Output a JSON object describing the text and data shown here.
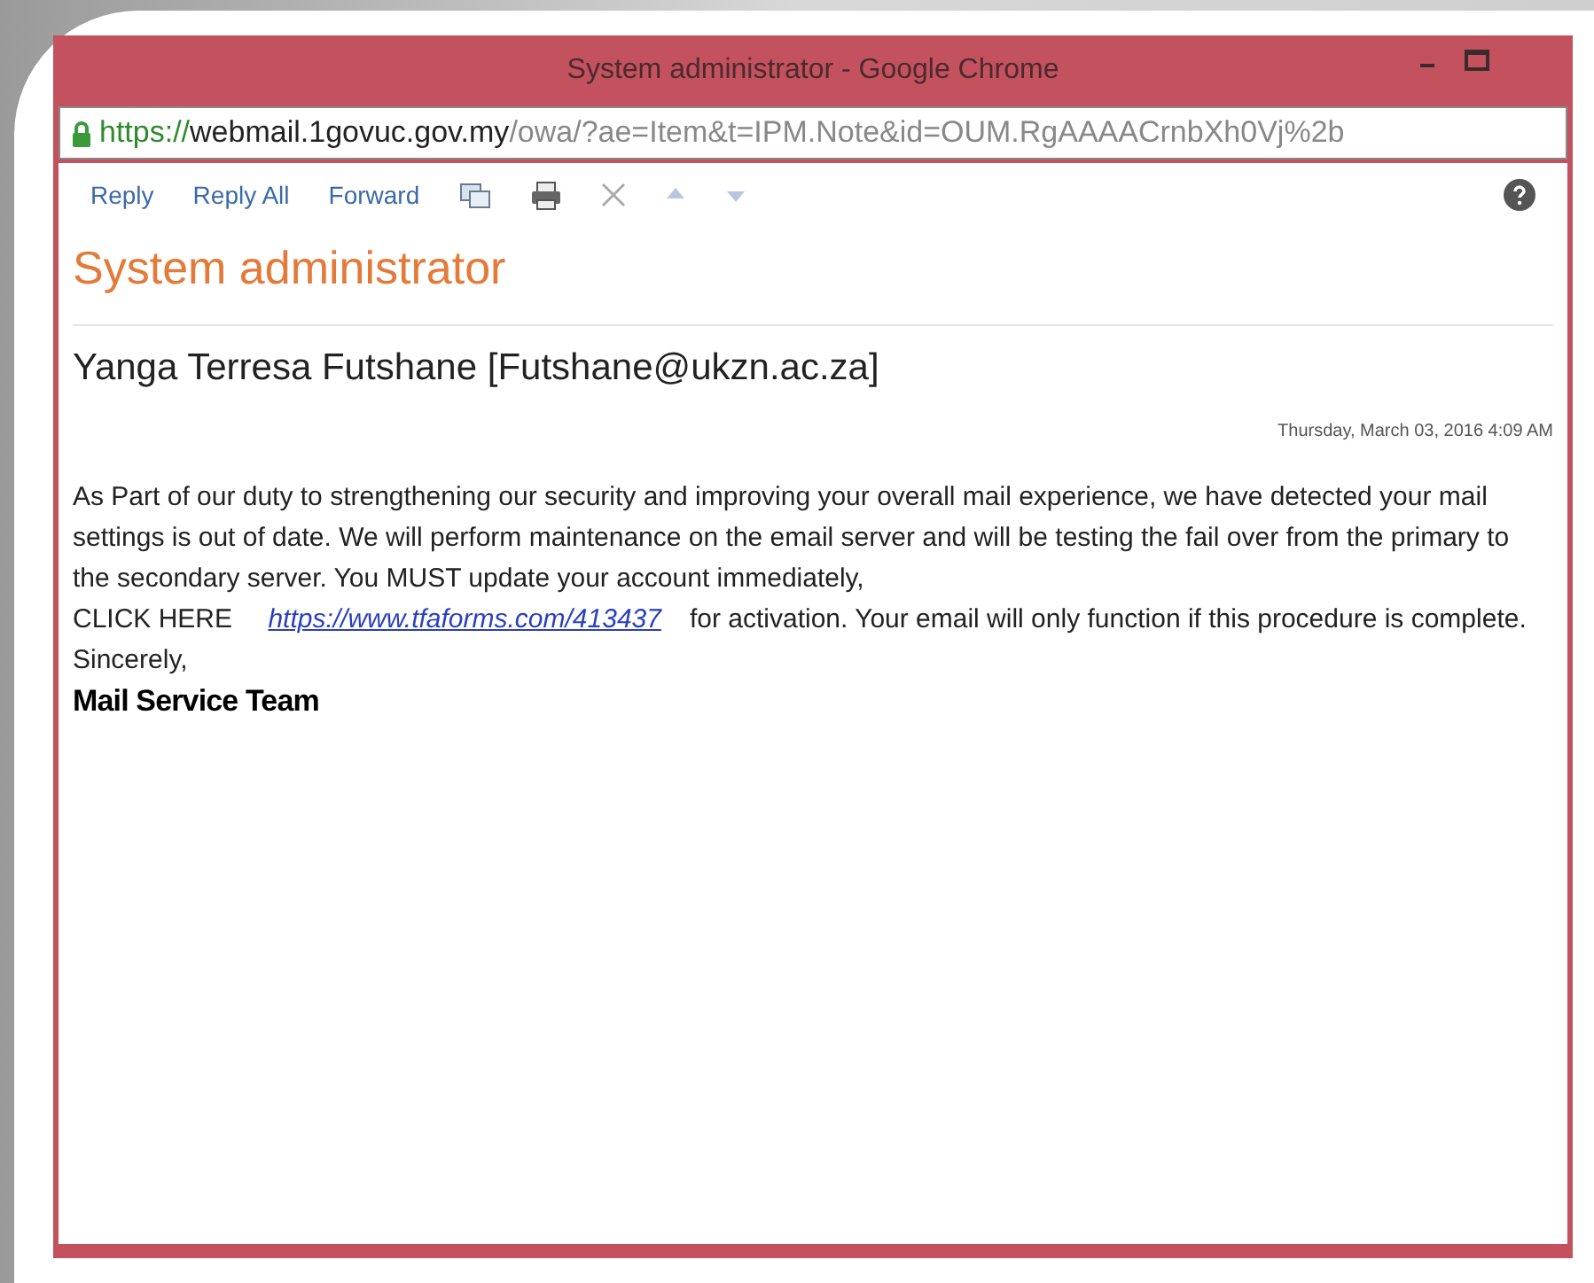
{
  "window": {
    "title": "System administrator - Google Chrome"
  },
  "address_bar": {
    "scheme": "https://",
    "host": "webmail.1govuc.gov.my",
    "path": "/owa/?ae=Item&t=IPM.Note&id=OUM.RgAAAACrnbXh0Vj%2b"
  },
  "toolbar": {
    "actions": [
      "Reply",
      "Reply All",
      "Forward"
    ]
  },
  "message": {
    "subject": "System administrator",
    "sender": "Yanga Terresa Futshane [Futshane@ukzn.ac.za]",
    "date": "Thursday, March 03, 2016 4:09 AM",
    "paragraph": "As Part of our duty to strengthening our security and improving your overall mail experience, we have detected your mail settings is out of date. We will perform maintenance on the email server and will be testing the fail over from the primary to the secondary server. You MUST update your account immediately,",
    "cta_label": "CLICK HERE",
    "link": "https://www.tfaforms.com/413437",
    "cta_text": "for activation. Your email will only function if this procedure is complete.",
    "closing": "Sincerely,",
    "signature": "Mail Service Team"
  }
}
